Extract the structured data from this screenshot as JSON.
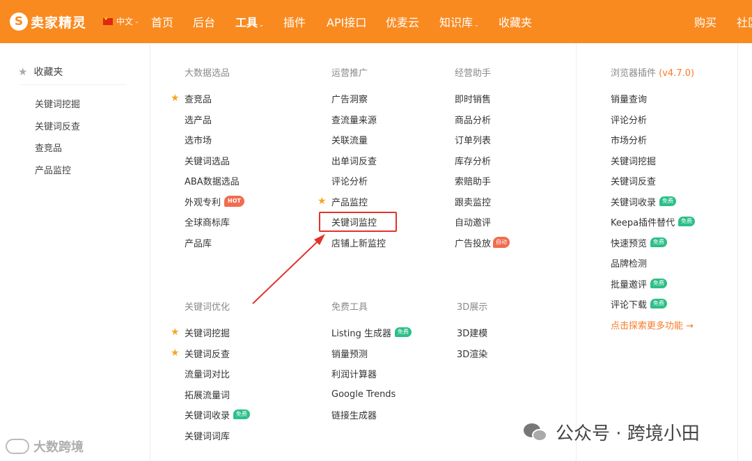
{
  "nav": {
    "logo_mark": "S",
    "logo_text": "卖家精灵",
    "lang": "中文",
    "items": [
      "首页",
      "后台",
      "工具",
      "插件",
      "API接口",
      "优麦云",
      "知识库",
      "收藏夹",
      "购买",
      "社区"
    ]
  },
  "favorites": {
    "title": "收藏夹",
    "items": [
      "关键词挖掘",
      "关键词反查",
      "查竞品",
      "产品监控"
    ]
  },
  "columns": {
    "bigdata": {
      "title": "大数据选品",
      "items": [
        "查竞品",
        "选产品",
        "选市场",
        "关键词选品",
        "ABA数据选品",
        "外观专利",
        "全球商标库",
        "产品库"
      ],
      "hot_badge": "HOT"
    },
    "operations": {
      "title": "运营推广",
      "items": [
        "广告洞察",
        "查流量来源",
        "关联流量",
        "出单词反查",
        "评论分析",
        "产品监控",
        "关键词监控",
        "店铺上新监控"
      ]
    },
    "assistant": {
      "title": "经营助手",
      "items": [
        "即时销售",
        "商品分析",
        "订单列表",
        "库存分析",
        "索赔助手",
        "跟卖监控",
        "自动邀评",
        "广告投放"
      ],
      "auto_badge": "自动"
    },
    "plugin": {
      "title": "浏览器插件",
      "version": "(v4.7.0)",
      "items": [
        "销量查询",
        "评论分析",
        "市场分析",
        "关键词挖掘",
        "关键词反查",
        "关键词收录",
        "Keepa插件替代",
        "快速预览",
        "品牌检测",
        "批量邀评",
        "评论下载"
      ],
      "more": "点击探索更多功能 →"
    },
    "keyword_opt": {
      "title": "关键词优化",
      "items": [
        "关键词挖掘",
        "关键词反查",
        "流量词对比",
        "拓展流量词",
        "关键词收录",
        "关键词词库"
      ]
    },
    "free_tools": {
      "title": "免费工具",
      "items": [
        "Listing 生成器",
        "销量预测",
        "利润计算器",
        "Google Trends",
        "链接生成器"
      ]
    },
    "three_d": {
      "title": "3D展示",
      "items": [
        "3D建模",
        "3D渲染"
      ]
    },
    "free_badge": "免费"
  },
  "watermark": {
    "left": "大数跨境",
    "right": "公众号 · 跨境小田"
  }
}
